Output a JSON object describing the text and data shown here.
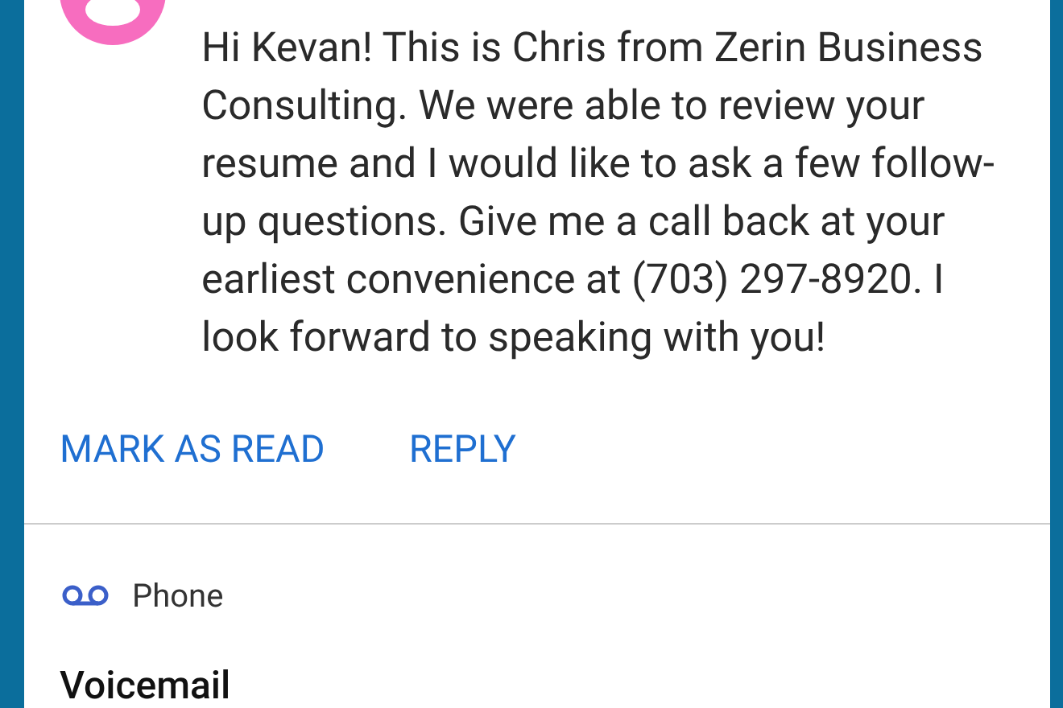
{
  "message": {
    "body": "Hi Kevan! This is Chris from Zerin Business Consulting. We were able to review your resume and I would like to ask a few follow-up questions. Give me a call back at your earliest convenience at (703) 297-8920. I look forward to speaking with you!"
  },
  "actions": [
    "MARK AS READ",
    "REPLY"
  ],
  "next": {
    "source": "Phone",
    "title": "Voicemail"
  }
}
